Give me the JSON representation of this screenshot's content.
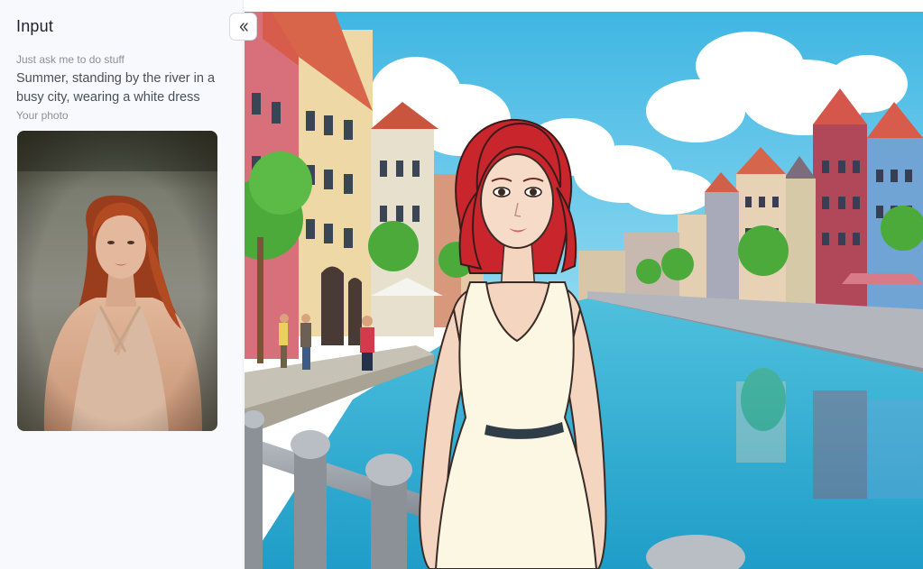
{
  "sidebar": {
    "title": "Input",
    "prompt_label": "Just ask me to do stuff",
    "prompt_text": "Summer, standing by the river in a busy city, wearing a white dress",
    "photo_label": "Your photo",
    "collapse_icon": "double-chevron-left-icon"
  },
  "colors": {
    "sidebar_bg": "#f8f9fc",
    "title_text": "#1f2329",
    "label_text": "#8a8f99",
    "body_text": "#4a4f57",
    "sky": "#5fc6e6",
    "water": "#3fb3d6",
    "hair_red": "#c8262c",
    "dress_white": "#fbf7e3"
  }
}
